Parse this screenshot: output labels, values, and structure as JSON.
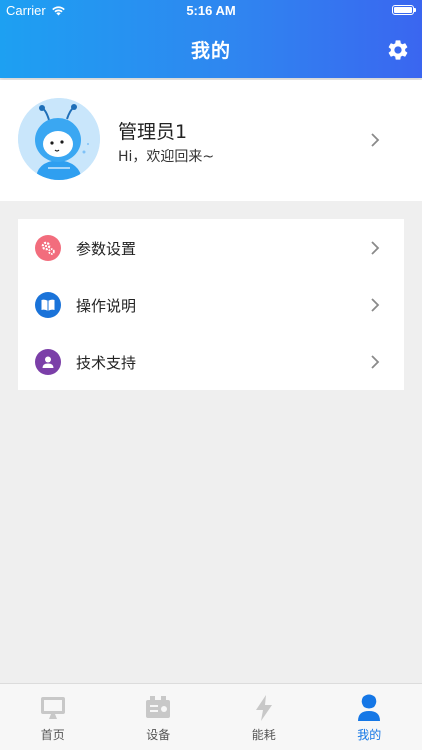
{
  "status_bar": {
    "carrier": "Carrier",
    "time": "5:16 AM",
    "battery_level": 1.0
  },
  "nav": {
    "title": "我的",
    "settings_icon": "gear-icon"
  },
  "profile": {
    "name": "管理员1",
    "greeting": "Hi，欢迎回来~",
    "avatar_icon": "cartoon-avatar"
  },
  "menu": {
    "items": [
      {
        "label": "参数设置",
        "icon": "gears-icon",
        "color": "#f26d7d"
      },
      {
        "label": "操作说明",
        "icon": "book-icon",
        "color": "#1a73d9"
      },
      {
        "label": "技术支持",
        "icon": "user-icon",
        "color": "#7b3fa8"
      }
    ]
  },
  "tabbar": {
    "items": [
      {
        "label": "首页",
        "icon": "monitor-icon",
        "active": false
      },
      {
        "label": "设备",
        "icon": "device-icon",
        "active": false
      },
      {
        "label": "能耗",
        "icon": "lightning-icon",
        "active": false
      },
      {
        "label": "我的",
        "icon": "person-icon",
        "active": true
      }
    ],
    "active_color": "#1577e6",
    "inactive_color": "#c8c8c8"
  }
}
